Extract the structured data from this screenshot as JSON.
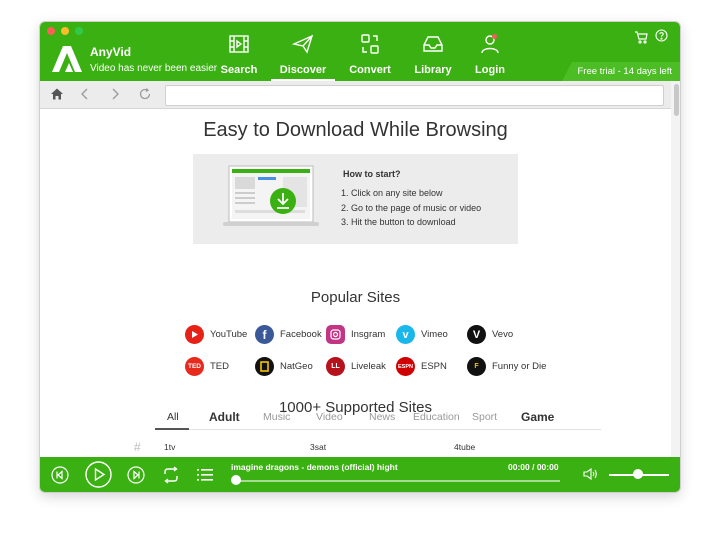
{
  "app": {
    "name": "AnyVid",
    "tagline": "Video has never been easier"
  },
  "nav": [
    {
      "label": "Search",
      "icon": "film-icon"
    },
    {
      "label": "Discover",
      "icon": "paper-plane-icon",
      "active": true
    },
    {
      "label": "Convert",
      "icon": "convert-icon"
    },
    {
      "label": "Library",
      "icon": "inbox-icon"
    },
    {
      "label": "Login",
      "icon": "user-icon"
    }
  ],
  "trial": "Free trial - 14 days left",
  "browser": {
    "url": ""
  },
  "page": {
    "title": "Easy to Download While Browsing",
    "howto": {
      "title": "How to start?",
      "steps": [
        "1. Click on any site below",
        "2. Go to the page of music or video",
        "3. Hit the button to download"
      ]
    },
    "popular_title": "Popular Sites",
    "popular_sites": [
      {
        "name": "YouTube",
        "color": "#e62117",
        "glyph": "▶"
      },
      {
        "name": "Facebook",
        "color": "#3b5998",
        "glyph": "f"
      },
      {
        "name": "Insgram",
        "color": "#c13584",
        "glyph": "◎"
      },
      {
        "name": "Vimeo",
        "color": "#1ab7ea",
        "glyph": "v"
      },
      {
        "name": "Vevo",
        "color": "#111111",
        "glyph": "V"
      },
      {
        "name": "TED",
        "color": "#e62b1e",
        "glyph": "TED"
      },
      {
        "name": "NatGeo",
        "color": "#111111",
        "glyph": "▯"
      },
      {
        "name": "Liveleak",
        "color": "#b5121b",
        "glyph": "LL"
      },
      {
        "name": "ESPN",
        "color": "#d00000",
        "glyph": "ESPN"
      },
      {
        "name": "Funny or Die",
        "color": "#111111",
        "glyph": "F"
      }
    ],
    "supported_title": "1000+ Supported Sites",
    "categories": [
      "All",
      "Adult",
      "Music",
      "Video",
      "News",
      "Education",
      "Sport",
      "Game"
    ],
    "rows": [
      {
        "hash": "#",
        "cols": [
          "1tv",
          "3sat",
          "4tube"
        ]
      }
    ]
  },
  "player": {
    "song": "imagine dragons - demons (official) hight",
    "time": "00:00 / 00:00",
    "progress": 0,
    "volume": 0.5
  },
  "colors": {
    "brand": "#3bb012"
  }
}
